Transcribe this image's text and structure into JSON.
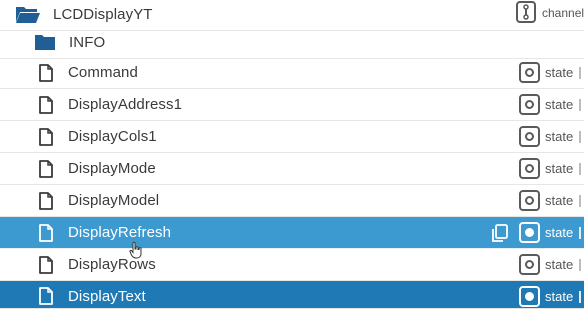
{
  "tree": {
    "root": {
      "name": "LCDDisplayYT",
      "icon": "folder-open-icon",
      "role": "channel"
    },
    "folder": {
      "name": "INFO",
      "icon": "folder-icon"
    },
    "states": [
      {
        "name": "Command",
        "role": "state"
      },
      {
        "name": "DisplayAddress1",
        "role": "state"
      },
      {
        "name": "DisplayCols1",
        "role": "state"
      },
      {
        "name": "DisplayMode",
        "role": "state"
      },
      {
        "name": "DisplayModel",
        "role": "state"
      },
      {
        "name": "DisplayRefresh",
        "role": "state"
      },
      {
        "name": "DisplayRows",
        "role": "state"
      },
      {
        "name": "DisplayText",
        "role": "state"
      }
    ]
  },
  "colors": {
    "hover_row": "#3d9ad1",
    "selected_row": "#1f79b4",
    "folder": "#1f5f96",
    "text": "#3a3a3a"
  }
}
